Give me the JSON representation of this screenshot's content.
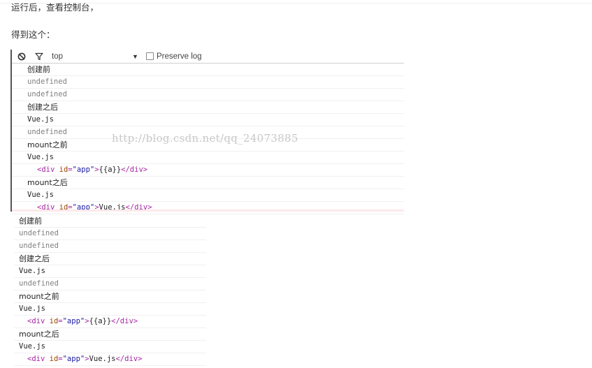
{
  "article": {
    "para_1": "运行后，查看控制台，",
    "para_2": "得到这个："
  },
  "console": {
    "context": "top",
    "preserve_log_label": "Preserve log",
    "icons": {
      "clear": "clear-console-icon",
      "filter": "filter-icon",
      "dropdown": "dropdown-arrow-icon"
    },
    "logs": [
      {
        "kind": "c",
        "text": "创建前"
      },
      {
        "kind": "u",
        "text": "undefined"
      },
      {
        "kind": "u",
        "text": "undefined"
      },
      {
        "kind": "c",
        "text": "创建之后"
      },
      {
        "kind": "m",
        "text": "Vue.js"
      },
      {
        "kind": "u",
        "text": "undefined"
      },
      {
        "kind": "c",
        "text": "mount之前"
      },
      {
        "kind": "m",
        "text": "Vue.js"
      },
      {
        "kind": "h",
        "open": "<div",
        "attr_name": "id",
        "attr_value": "\"app\"",
        "close": ">",
        "content": "{{a}}",
        "end_tag": "</div>"
      },
      {
        "kind": "c",
        "text": "mount之后"
      },
      {
        "kind": "m",
        "text": "Vue.js"
      },
      {
        "kind": "h",
        "open": "<div",
        "attr_name": "id",
        "attr_value": "\"app\"",
        "close": ">",
        "content": "Vue.js",
        "end_tag": "</div>"
      }
    ]
  },
  "second_logs": [
    {
      "kind": "c",
      "text": "创建前"
    },
    {
      "kind": "u",
      "text": "undefined"
    },
    {
      "kind": "u",
      "text": "undefined"
    },
    {
      "kind": "c",
      "text": "创建之后"
    },
    {
      "kind": "m",
      "text": "Vue.js"
    },
    {
      "kind": "u",
      "text": "undefined"
    },
    {
      "kind": "c",
      "text": "mount之前"
    },
    {
      "kind": "m",
      "text": "Vue.js"
    },
    {
      "kind": "h",
      "open": "<div",
      "attr_name": "id",
      "attr_value": "\"app\"",
      "close": ">",
      "content": "{{a}}",
      "end_tag": "</div>"
    },
    {
      "kind": "c",
      "text": "mount之后"
    },
    {
      "kind": "m",
      "text": "Vue.js"
    },
    {
      "kind": "h",
      "open": "<div",
      "attr_name": "id",
      "attr_value": "\"app\"",
      "close": ">",
      "content": "Vue.js",
      "end_tag": "</div>"
    }
  ],
  "watermark": "http://blog.csdn.net/qq_24073885",
  "colors": {
    "tag": "#a626a4",
    "attr_name": "#994500",
    "attr_value": "#1a1aa6",
    "muted": "#808080"
  }
}
